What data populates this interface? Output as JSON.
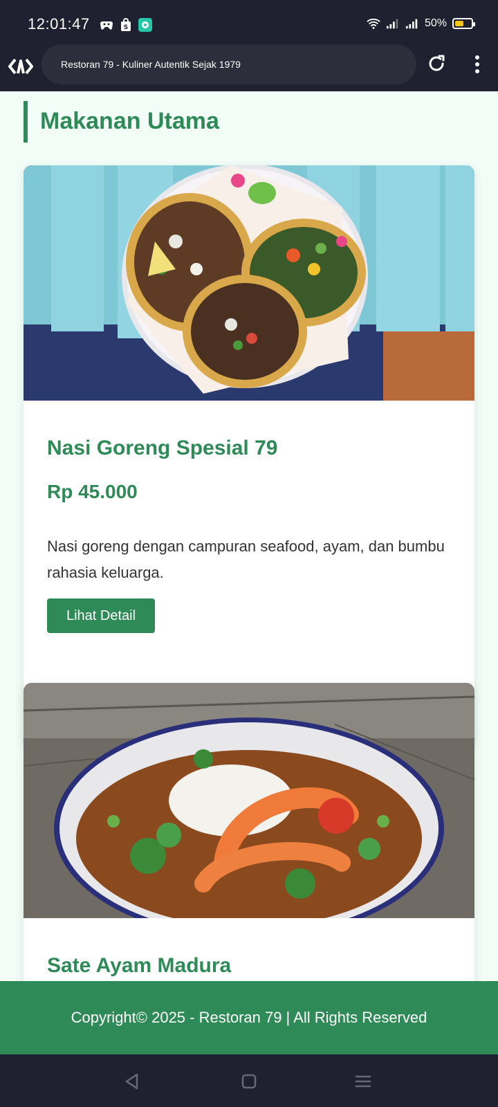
{
  "status": {
    "time": "12:01:47",
    "battery_percent": "50%",
    "battery_level": 0.5,
    "battery_color": "#f5c518"
  },
  "browser": {
    "url_title": "Restoran 79 - Kuliner Autentik Sejak 1979"
  },
  "section": {
    "title": "Makanan Utama"
  },
  "menu_items": [
    {
      "name": "Nasi Goreng Spesial 79",
      "price": "Rp 45.000",
      "description": "Nasi goreng dengan campuran seafood, ayam, dan bumbu rahasia keluarga.",
      "button_label": "Lihat Detail",
      "image": "tacos-plate-photo"
    },
    {
      "name": "Sate Ayam Madura",
      "image": "shrimp-gumbo-bowl-photo"
    }
  ],
  "footer": {
    "text": "Copyright© 2025 - Restoran 79 | All Rights Reserved"
  },
  "colors": {
    "accent": "#2e8b57",
    "page_bg": "#f1fdf6",
    "system_bar": "#1f2030"
  }
}
